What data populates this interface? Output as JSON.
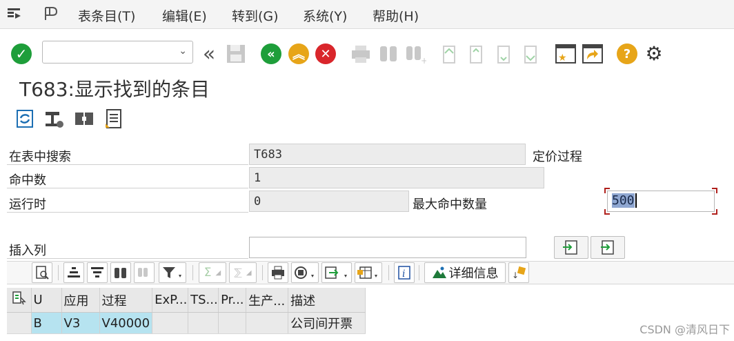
{
  "menu": {
    "items": [
      "表条目(T)",
      "编辑(E)",
      "转到(G)",
      "系统(Y)",
      "帮助(H)"
    ]
  },
  "toolbar": {
    "command_value": ""
  },
  "title": "T683:显示找到的条目",
  "form": {
    "search_table_label": "在表中搜索",
    "search_table_value": "T683",
    "search_table_desc": "定价过程",
    "hits_label": "命中数",
    "hits_value": "1",
    "runtime_label": "运行时",
    "runtime_value": "0",
    "max_hits_label": "最大命中数量",
    "max_hits_value": "500",
    "insert_col_label": "插入列",
    "insert_col_value": ""
  },
  "grid_toolbar": {
    "details_label": "详细信息"
  },
  "table": {
    "headers": [
      "U",
      "应用",
      "过程",
      "ExP...",
      "TS...",
      "Pr...",
      "生产...",
      "描述"
    ],
    "rows": [
      [
        "B",
        "V3",
        "V40000",
        "",
        "",
        "",
        "",
        "公司间开票"
      ]
    ]
  },
  "watermark": "CSDN @清风日下",
  "colors": {
    "ok_green": "#1e9e3a",
    "back_green": "#1e9e3a",
    "exit_yellow": "#e7a519",
    "cancel_red": "#d9262b",
    "key_cell": "#b6e3f0",
    "focus_corner": "#b0201c"
  }
}
